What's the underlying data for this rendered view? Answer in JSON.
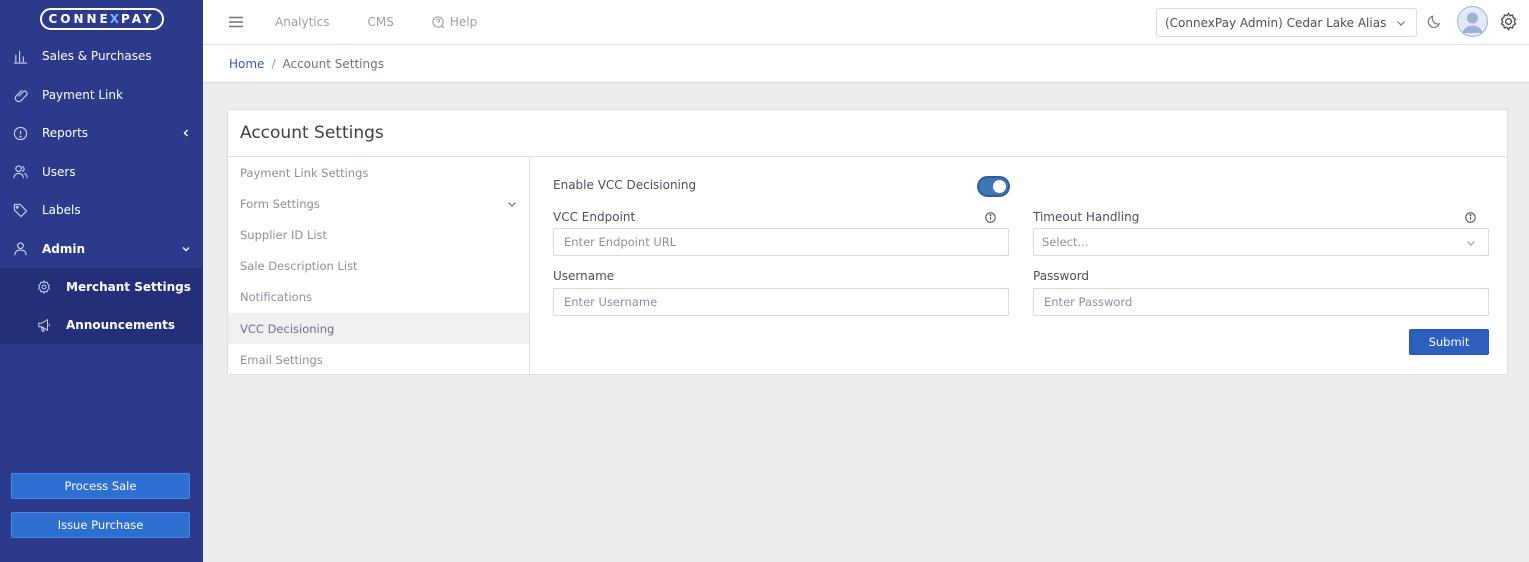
{
  "brand": {
    "logo_left": "CONNE",
    "logo_x": "X",
    "logo_right": "PAY"
  },
  "sidebar": {
    "items": [
      {
        "label": "Sales & Purchases",
        "icon": "bar-chart-icon"
      },
      {
        "label": "Payment Link",
        "icon": "link-icon"
      },
      {
        "label": "Reports",
        "icon": "info-circle-icon"
      },
      {
        "label": "Users",
        "icon": "users-icon"
      },
      {
        "label": "Labels",
        "icon": "tag-icon"
      },
      {
        "label": "Admin",
        "icon": "user-icon"
      }
    ],
    "admin_sub": [
      {
        "label": "Merchant Settings",
        "icon": "gear-icon"
      },
      {
        "label": "Announcements",
        "icon": "megaphone-icon"
      }
    ],
    "process_sale": "Process Sale",
    "issue_purchase": "Issue Purchase"
  },
  "topbar": {
    "nav": [
      "Analytics",
      "CMS",
      "Help"
    ],
    "merchant": "(ConnexPay Admin) Cedar Lake Alias"
  },
  "breadcrumb": {
    "home": "Home",
    "sep": "/",
    "current": "Account Settings"
  },
  "page": {
    "title": "Account Settings",
    "settings_nav": [
      "Payment Link Settings",
      "Form Settings",
      "Supplier ID List",
      "Sale Description List",
      "Notifications",
      "VCC Decisioning",
      "Email Settings"
    ],
    "active_nav": "VCC Decisioning",
    "form": {
      "enable_label": "Enable VCC Decisioning",
      "enabled": true,
      "endpoint_label": "VCC Endpoint",
      "endpoint_placeholder": "Enter Endpoint URL",
      "timeout_label": "Timeout Handling",
      "timeout_placeholder": "Select...",
      "username_label": "Username",
      "username_placeholder": "Enter Username",
      "password_label": "Password",
      "password_placeholder": "Enter Password",
      "submit": "Submit"
    }
  },
  "colors": {
    "sidebar": "#2c3a8c",
    "accent": "#2e5fbf",
    "toggle": "#3d77b8"
  }
}
